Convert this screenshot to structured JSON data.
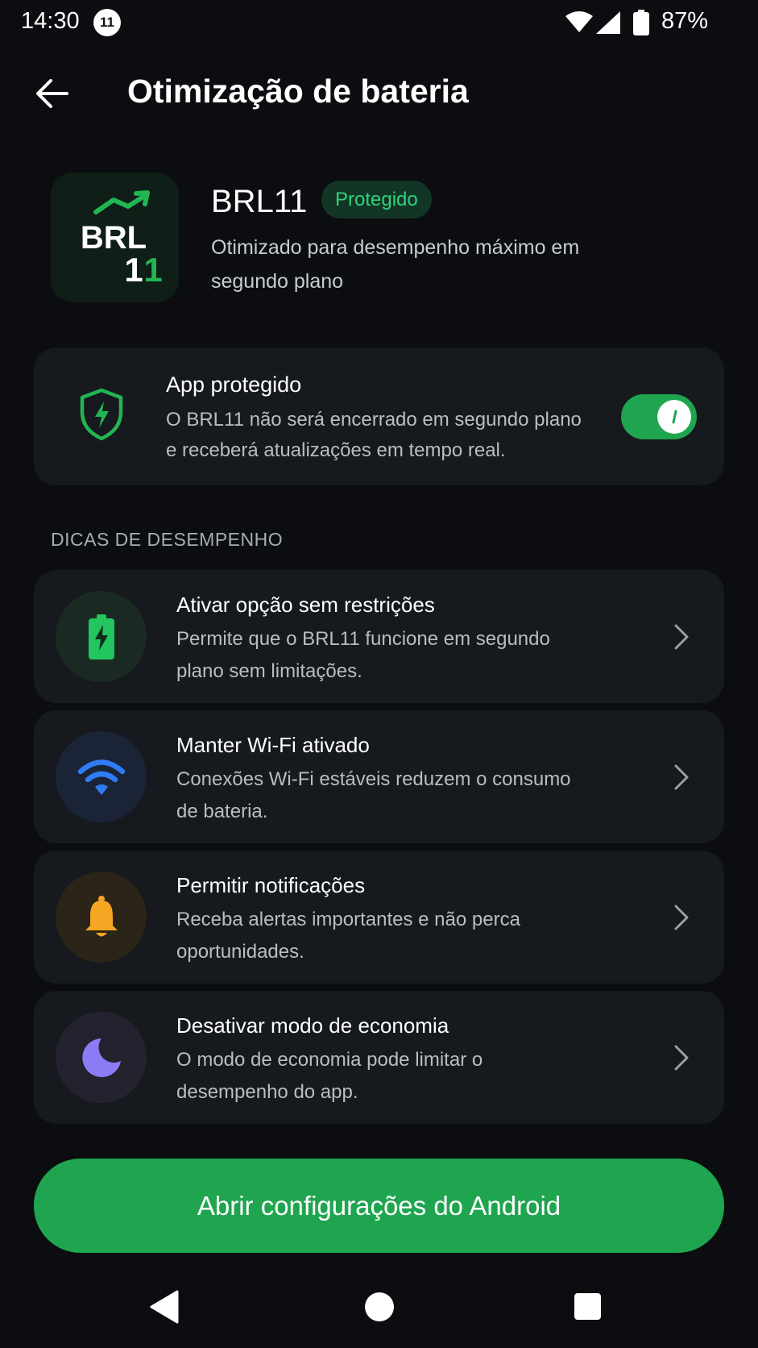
{
  "status_bar": {
    "time": "14:30",
    "notification_count": "11",
    "battery_percent": "87%"
  },
  "header": {
    "title": "Otimização de bateria",
    "back_icon": "arrow-left-icon"
  },
  "app": {
    "name": "BRL11",
    "logo_text_top": "BRL",
    "logo_text_bottom": "11",
    "badge": "Protegido",
    "description": "Otimizado para desempenho máximo em segundo plano"
  },
  "protection": {
    "title": "App protegido",
    "description": "O BRL11 não será encerrado em segundo plano e receberá atualizações em tempo real.",
    "enabled": true,
    "icon": "shield-bolt-icon"
  },
  "tips_section": {
    "title": "DICAS DE DESEMPENHO",
    "items": [
      {
        "title": "Ativar opção sem restrições",
        "description": "Permite que o BRL11 funcione em segundo plano sem limitações.",
        "icon": "battery-charging-icon"
      },
      {
        "title": "Manter Wi-Fi ativado",
        "description": "Conexões Wi-Fi estáveis reduzem o consumo de bateria.",
        "icon": "wifi-icon"
      },
      {
        "title": "Permitir notificações",
        "description": "Receba alertas importantes e não perca oportunidades.",
        "icon": "bell-icon"
      },
      {
        "title": "Desativar modo de economia",
        "description": "O modo de economia pode limitar o desempenho do app.",
        "icon": "moon-icon"
      }
    ]
  },
  "primary_action": {
    "label": "Abrir configurações do Android"
  },
  "colors": {
    "background": "#0b0d10",
    "card": "#16191d",
    "accent_green": "#1fa54f",
    "badge_text": "#2ed47a",
    "wifi_blue": "#2f7cf6",
    "bell_amber": "#f5a623",
    "moon_purple": "#8b7cf6"
  }
}
